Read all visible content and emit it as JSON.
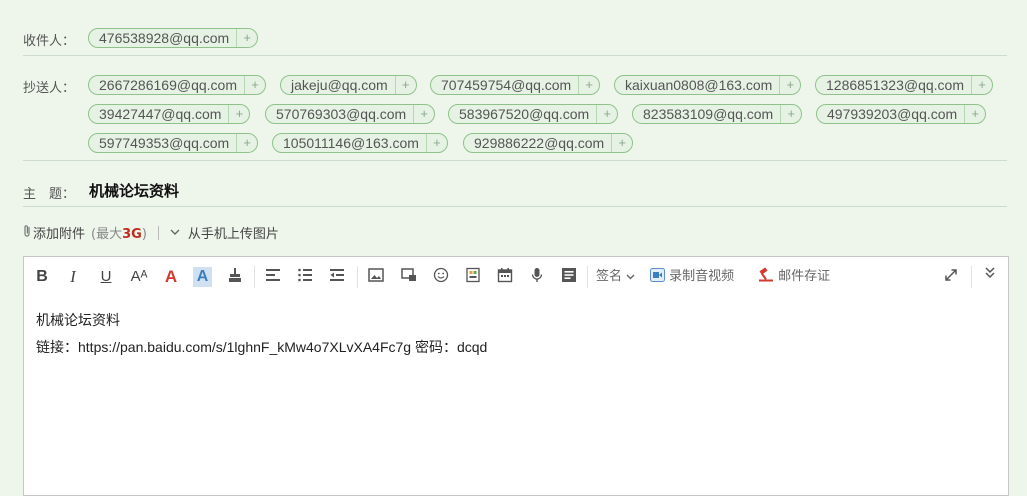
{
  "recipient": {
    "label": "收件人：",
    "chips": [
      "476538928@qq.com"
    ],
    "plus": "+"
  },
  "cc": {
    "label": "抄送人：",
    "chips": [
      "2667286169@qq.com",
      "jakeju@qq.com",
      "707459754@qq.com",
      "kaixuan0808@163.com",
      "1286851323@qq.com",
      "39427447@qq.com",
      "570769303@qq.com",
      "583967520@qq.com",
      "823583109@qq.com",
      "497939203@qq.com",
      "597749353@qq.com",
      "105011146@163.com",
      "929886222@qq.com"
    ]
  },
  "subject": {
    "label": "主　题：",
    "value": "机械论坛资料"
  },
  "attachments": {
    "add_label": "添加附件",
    "limit_prefix": "(最大",
    "limit_value": "3G",
    "limit_suffix": ")",
    "upload_label": "从手机上传图片"
  },
  "toolbar": {
    "bold": "B",
    "italic": "I",
    "underline": "U",
    "font_size": "Aᴬ",
    "font_color": "A",
    "bg_color": "A",
    "signature_label": "签名",
    "record_label": "录制音视频",
    "archive_label": "邮件存证"
  },
  "body": {
    "line1": "机械论坛资料",
    "line2": "链接：https://pan.baidu.com/s/1lghnF_kMw4o7XLvXA4Fc7g 密码：dcqd"
  },
  "colors": {
    "background": "#eef6ec",
    "chip_border": "#8fc28a",
    "accent_red": "#c02a1c",
    "font_color_A": "#d23a2f",
    "bg_color_A": "#3b7fbf"
  }
}
